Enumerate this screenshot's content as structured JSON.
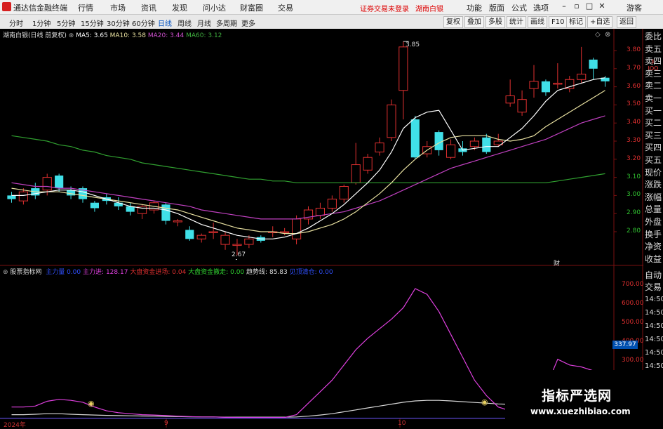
{
  "app": {
    "name": "通达信金融终端",
    "menus": [
      "行情",
      "市场",
      "资讯",
      "发现",
      "问小达",
      "财富圈",
      "交易"
    ],
    "warning": "证券交易未登录",
    "stock_title": "湖南白银",
    "right_menus": [
      "功能",
      "版面",
      "公式",
      "选项"
    ],
    "guest": "游客"
  },
  "tabs": {
    "left": [
      "分时",
      "1分钟",
      "5分钟",
      "15分钟",
      "30分钟",
      "60分钟",
      "日线",
      "周线",
      "月线",
      "多周期",
      "更多"
    ],
    "active": "日线",
    "right": [
      "复权",
      "叠加",
      "多股",
      "统计",
      "画线",
      "F10",
      "标记",
      "+自选",
      "返回"
    ]
  },
  "main_header": {
    "name": "湖南白银(日线 前复权)",
    "ma5_label": "MA5:",
    "ma5": "3.65",
    "ma10_label": "MA10:",
    "ma10": "3.58",
    "ma20_label": "MA20:",
    "ma20": "3.44",
    "ma60_label": "MA60:",
    "ma60": "3.12"
  },
  "price_axis": [
    "3.80",
    "3.70",
    "3.60",
    "3.50",
    "3.40",
    "3.30",
    "3.20",
    "3.10",
    "3.00",
    "2.90",
    "2.80"
  ],
  "annotations": {
    "high": "3.85",
    "low": "2.67",
    "event": "财"
  },
  "indicator_header": {
    "name": "股票指标网",
    "zhuli_label": "主力量",
    "zhuli": "0.00",
    "zhulijin_label": "主力进",
    "zhulijin": "128.17",
    "dapan_in_label": "大盘资金进场",
    "dapan_in": "0.04",
    "dapan_out_label": "大盘资金撤走",
    "dapan_out": "0.00",
    "trend_label": "趋势线",
    "trend": "85.83",
    "chip_label": "见顶清仓",
    "chip": "0.00"
  },
  "indicator_axis": [
    "700.00",
    "600.00",
    "500.00",
    "400.00",
    "300.00"
  ],
  "indicator_current": "337.97",
  "date_labels": [
    "2024年",
    "9",
    "10"
  ],
  "side_labels": [
    "委比",
    "卖五",
    "卖四",
    "卖三",
    "卖二",
    "卖一",
    "买一",
    "买二",
    "买三",
    "买四",
    "买五",
    "现价",
    "涨跌",
    "涨幅",
    "总量",
    "外盘",
    "换手",
    "净资",
    "收益"
  ],
  "side_status": "R\nIOO",
  "side_bottom": [
    "自动",
    "交易"
  ],
  "clock": [
    "14:50",
    "14:50",
    "14:50",
    "14:50",
    "14:50",
    "14:50",
    "14:50",
    "14:50",
    "14:50"
  ],
  "watermark": {
    "cn": "指标严选网",
    "url": "www.xuezhibiao.com"
  },
  "colors": {
    "up": "#e03030",
    "down": "#40e0e8",
    "ma5": "#ffffff",
    "ma10": "#e8e0a0",
    "ma20": "#c040c0",
    "ma60": "#30a030",
    "indicator": "#e040e0"
  },
  "chart_data": {
    "type": "candlestick",
    "ylim": [
      2.6,
      3.9
    ],
    "candles": [
      {
        "o": 3.0,
        "c": 2.98,
        "h": 3.02,
        "l": 2.96
      },
      {
        "o": 2.97,
        "c": 3.02,
        "h": 3.04,
        "l": 2.95
      },
      {
        "o": 3.04,
        "c": 3.0,
        "h": 3.07,
        "l": 2.98
      },
      {
        "o": 3.03,
        "c": 3.1,
        "h": 3.12,
        "l": 3.0
      },
      {
        "o": 3.11,
        "c": 3.04,
        "h": 3.12,
        "l": 3.02
      },
      {
        "o": 3.03,
        "c": 3.0,
        "h": 3.05,
        "l": 2.98
      },
      {
        "o": 3.04,
        "c": 2.98,
        "h": 3.05,
        "l": 2.96
      },
      {
        "o": 2.96,
        "c": 2.93,
        "h": 2.97,
        "l": 2.91
      },
      {
        "o": 2.99,
        "c": 2.97,
        "h": 3.01,
        "l": 2.95
      },
      {
        "o": 2.96,
        "c": 2.94,
        "h": 2.99,
        "l": 2.92
      },
      {
        "o": 2.94,
        "c": 2.91,
        "h": 2.96,
        "l": 2.89
      },
      {
        "o": 2.9,
        "c": 2.94,
        "h": 2.95,
        "l": 2.87
      },
      {
        "o": 2.92,
        "c": 2.96,
        "h": 2.97,
        "l": 2.9
      },
      {
        "o": 2.95,
        "c": 2.86,
        "h": 2.96,
        "l": 2.84
      },
      {
        "o": 2.86,
        "c": 2.86,
        "h": 2.87,
        "l": 2.83
      },
      {
        "o": 2.81,
        "c": 2.76,
        "h": 2.83,
        "l": 2.75
      },
      {
        "o": 2.76,
        "c": 2.78,
        "h": 2.79,
        "l": 2.74
      },
      {
        "o": 2.8,
        "c": 2.8,
        "h": 2.85,
        "l": 2.76
      },
      {
        "o": 2.73,
        "c": 2.78,
        "h": 2.8,
        "l": 2.7
      },
      {
        "o": 2.73,
        "c": 2.73,
        "h": 2.76,
        "l": 2.67
      },
      {
        "o": 2.73,
        "c": 2.76,
        "h": 2.78,
        "l": 2.71
      },
      {
        "o": 2.77,
        "c": 2.75,
        "h": 2.78,
        "l": 2.74
      },
      {
        "o": 2.8,
        "c": 2.8,
        "h": 2.83,
        "l": 2.77
      },
      {
        "o": 2.8,
        "c": 2.8,
        "h": 2.82,
        "l": 2.78
      },
      {
        "o": 2.76,
        "c": 2.87,
        "h": 2.89,
        "l": 2.73
      },
      {
        "o": 2.87,
        "c": 2.92,
        "h": 2.94,
        "l": 2.84
      },
      {
        "o": 2.89,
        "c": 2.93,
        "h": 2.96,
        "l": 2.87
      },
      {
        "o": 2.93,
        "c": 2.98,
        "h": 3.0,
        "l": 2.91
      },
      {
        "o": 2.98,
        "c": 3.05,
        "h": 3.06,
        "l": 2.96
      },
      {
        "o": 3.07,
        "c": 3.17,
        "h": 3.29,
        "l": 3.06
      },
      {
        "o": 3.14,
        "c": 3.21,
        "h": 3.23,
        "l": 3.12
      },
      {
        "o": 3.24,
        "c": 3.29,
        "h": 3.32,
        "l": 3.22
      },
      {
        "o": 3.32,
        "c": 3.5,
        "h": 3.53,
        "l": 3.3
      },
      {
        "o": 3.58,
        "c": 3.82,
        "h": 3.85,
        "l": 3.42
      },
      {
        "o": 3.42,
        "c": 3.21,
        "h": 3.44,
        "l": 3.2
      },
      {
        "o": 3.23,
        "c": 3.27,
        "h": 3.3,
        "l": 3.21
      },
      {
        "o": 3.35,
        "c": 3.25,
        "h": 3.36,
        "l": 3.22
      },
      {
        "o": 3.21,
        "c": 3.28,
        "h": 3.31,
        "l": 3.2
      },
      {
        "o": 3.26,
        "c": 3.24,
        "h": 3.3,
        "l": 3.22
      },
      {
        "o": 3.27,
        "c": 3.3,
        "h": 3.32,
        "l": 3.25
      },
      {
        "o": 3.32,
        "c": 3.24,
        "h": 3.34,
        "l": 3.23
      },
      {
        "o": 3.28,
        "c": 3.3,
        "h": 3.34,
        "l": 3.27
      },
      {
        "o": 3.51,
        "c": 3.55,
        "h": 3.64,
        "l": 3.49
      },
      {
        "o": 3.46,
        "c": 3.53,
        "h": 3.58,
        "l": 3.44
      },
      {
        "o": 3.59,
        "c": 3.63,
        "h": 3.72,
        "l": 3.54
      },
      {
        "o": 3.63,
        "c": 3.57,
        "h": 3.64,
        "l": 3.55
      },
      {
        "o": 3.62,
        "c": 3.62,
        "h": 3.73,
        "l": 3.59
      },
      {
        "o": 3.59,
        "c": 3.64,
        "h": 3.66,
        "l": 3.57
      },
      {
        "o": 3.64,
        "c": 3.67,
        "h": 3.82,
        "l": 3.62
      },
      {
        "o": 3.75,
        "c": 3.7,
        "h": 3.76,
        "l": 3.64
      },
      {
        "o": 3.65,
        "c": 3.63,
        "h": 3.66,
        "l": 3.6
      }
    ],
    "ma5": [
      3.0,
      3.0,
      3.01,
      3.02,
      3.03,
      3.03,
      3.02,
      3.0,
      2.98,
      2.96,
      2.94,
      2.93,
      2.93,
      2.92,
      2.9,
      2.87,
      2.84,
      2.82,
      2.8,
      2.78,
      2.77,
      2.76,
      2.76,
      2.77,
      2.79,
      2.82,
      2.86,
      2.9,
      2.95,
      3.01,
      3.07,
      3.14,
      3.24,
      3.37,
      3.43,
      3.46,
      3.47,
      3.36,
      3.25,
      3.26,
      3.27,
      3.27,
      3.32,
      3.37,
      3.44,
      3.52,
      3.58,
      3.6,
      3.62,
      3.64,
      3.65
    ],
    "ma10": [
      3.04,
      3.03,
      3.02,
      3.02,
      3.02,
      3.01,
      3.0,
      2.99,
      2.98,
      2.97,
      2.96,
      2.95,
      2.94,
      2.93,
      2.92,
      2.9,
      2.88,
      2.86,
      2.84,
      2.82,
      2.81,
      2.8,
      2.8,
      2.79,
      2.79,
      2.8,
      2.82,
      2.84,
      2.87,
      2.91,
      2.96,
      3.01,
      3.07,
      3.14,
      3.2,
      3.25,
      3.29,
      3.32,
      3.33,
      3.33,
      3.33,
      3.31,
      3.3,
      3.31,
      3.33,
      3.38,
      3.42,
      3.46,
      3.5,
      3.54,
      3.58
    ],
    "ma20": [
      3.07,
      3.06,
      3.05,
      3.05,
      3.04,
      3.04,
      3.03,
      3.02,
      3.01,
      3.0,
      2.99,
      2.98,
      2.97,
      2.96,
      2.95,
      2.94,
      2.92,
      2.91,
      2.9,
      2.89,
      2.88,
      2.87,
      2.87,
      2.87,
      2.87,
      2.88,
      2.89,
      2.9,
      2.91,
      2.93,
      2.95,
      2.97,
      3.0,
      3.03,
      3.06,
      3.09,
      3.12,
      3.15,
      3.17,
      3.19,
      3.21,
      3.23,
      3.25,
      3.27,
      3.29,
      3.31,
      3.34,
      3.37,
      3.4,
      3.42,
      3.44
    ],
    "ma60": [
      3.33,
      3.32,
      3.31,
      3.3,
      3.28,
      3.27,
      3.25,
      3.24,
      3.22,
      3.21,
      3.2,
      3.18,
      3.17,
      3.16,
      3.15,
      3.14,
      3.13,
      3.12,
      3.11,
      3.1,
      3.09,
      3.09,
      3.08,
      3.08,
      3.07,
      3.07,
      3.07,
      3.07,
      3.07,
      3.07,
      3.07,
      3.07,
      3.07,
      3.07,
      3.07,
      3.07,
      3.07,
      3.07,
      3.07,
      3.07,
      3.07,
      3.07,
      3.07,
      3.07,
      3.07,
      3.07,
      3.08,
      3.09,
      3.1,
      3.11,
      3.12
    ],
    "indicator_ylim": [
      0,
      750
    ],
    "indicator_main": [
      60,
      60,
      65,
      90,
      100,
      95,
      85,
      60,
      40,
      30,
      25,
      20,
      18,
      15,
      12,
      10,
      8,
      8,
      6,
      5,
      5,
      5,
      5,
      5,
      20,
      80,
      140,
      200,
      280,
      360,
      420,
      470,
      520,
      580,
      680,
      650,
      560,
      440,
      320,
      200,
      120,
      60,
      40,
      20,
      15,
      160,
      310,
      280,
      270,
      250,
      230
    ],
    "indicator_white": [
      20,
      20,
      22,
      25,
      25,
      22,
      20,
      18,
      16,
      15,
      14,
      13,
      12,
      11,
      10,
      9,
      8,
      8,
      7,
      7,
      7,
      7,
      7,
      7,
      8,
      12,
      18,
      25,
      35,
      45,
      55,
      65,
      75,
      85,
      92,
      95,
      95,
      92,
      88,
      84,
      80,
      76,
      74,
      72,
      70,
      72,
      76,
      80,
      84,
      86,
      88
    ]
  }
}
